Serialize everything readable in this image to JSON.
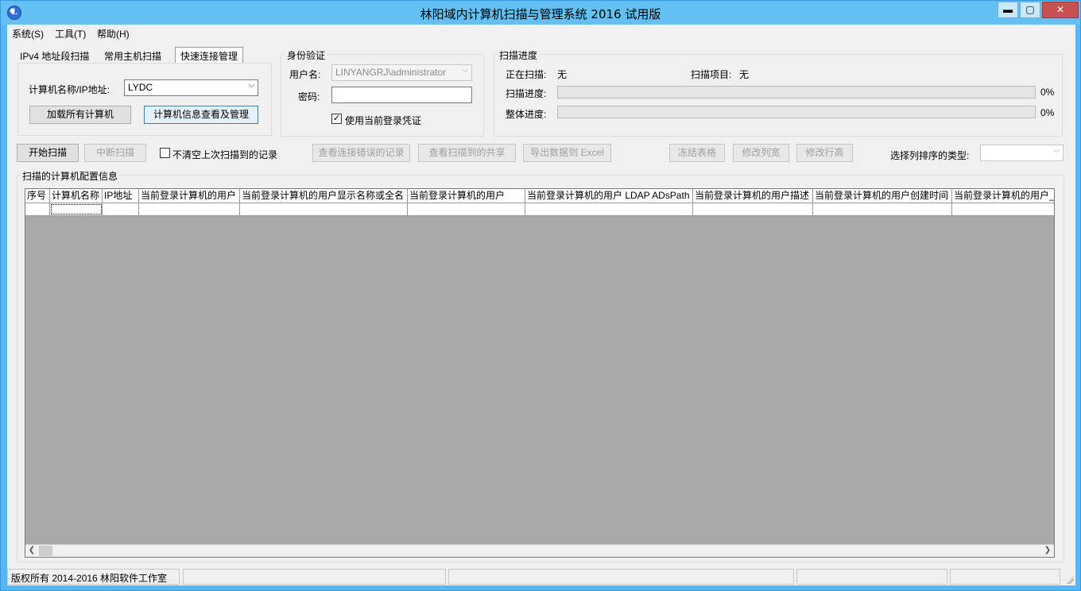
{
  "window": {
    "title": "林阳域内计算机扫描与管理系统 2016 试用版",
    "min": "▬",
    "max": "▢",
    "close": "✕"
  },
  "menu": [
    "系统(S)",
    "工具(T)",
    "帮助(H)"
  ],
  "tabs": [
    "IPv4 地址段扫描",
    "常用主机扫描",
    "快速连接管理"
  ],
  "quick": {
    "label": "计算机名称/IP地址:",
    "value": "LYDC",
    "load_all": "加载所有计算机",
    "manage": "计算机信息查看及管理"
  },
  "auth": {
    "title": "身份验证",
    "user_label": "用户名:",
    "user_value": "LINYANGRJ\\administrator",
    "pwd_label": "密码:",
    "use_current": "使用当前登录凭证",
    "use_current_checked": true
  },
  "progress": {
    "title": "扫描进度",
    "scanning_label": "正在扫描:",
    "scanning_value": "无",
    "item_label": "扫描项目:",
    "item_value": "无",
    "scan_label": "扫描进度:",
    "scan_pct": "0%",
    "scan_fraction": 0,
    "total_label": "整体进度:",
    "total_pct": "0%",
    "total_fraction": 0
  },
  "toolbar": {
    "start": "开始扫描",
    "stop": "中断扫描",
    "keep": "不清空上次扫描到的记录",
    "errors": "查看连接错误的记录",
    "shares": "查看扫描到的共享",
    "export": "导出数据到 Excel",
    "freeze": "冻结表格",
    "col_width": "修改列宽",
    "row_height": "修改行高",
    "sort_label": "选择列排序的类型:"
  },
  "grid": {
    "title": "扫描的计算机配置信息",
    "columns": [
      "序号",
      "计算机名称",
      "IP地址",
      "当前登录计算机的用户",
      "当前登录计算机的用户显示名称或全名",
      "当前登录计算机的用户",
      "当前登录计算机的用户 LDAP ADsPath",
      "当前登录计算机的用户描述",
      "当前登录计算机的用户创建时间",
      "当前登录计算机的用户_"
    ]
  },
  "status": {
    "copyright": "版权所有 2014-2016 林阳软件工作室"
  }
}
